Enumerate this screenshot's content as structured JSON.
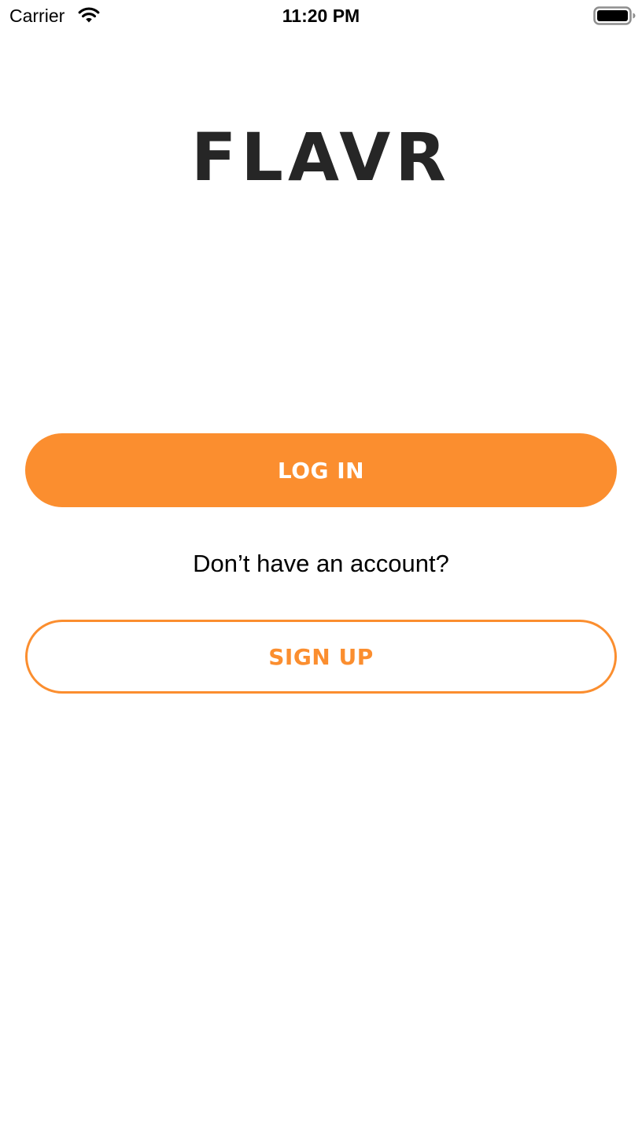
{
  "status_bar": {
    "carrier": "Carrier",
    "time": "11:20 PM",
    "wifi_icon": "wifi-icon",
    "battery_icon": "battery-full-icon"
  },
  "app": {
    "logo_text": "FLAVR"
  },
  "auth": {
    "login_label": "LOG IN",
    "prompt_text": "Don’t have an account?",
    "signup_label": "SIGN UP"
  },
  "colors": {
    "accent": "#fb8e2f",
    "logo": "#262626",
    "background": "#ffffff"
  }
}
